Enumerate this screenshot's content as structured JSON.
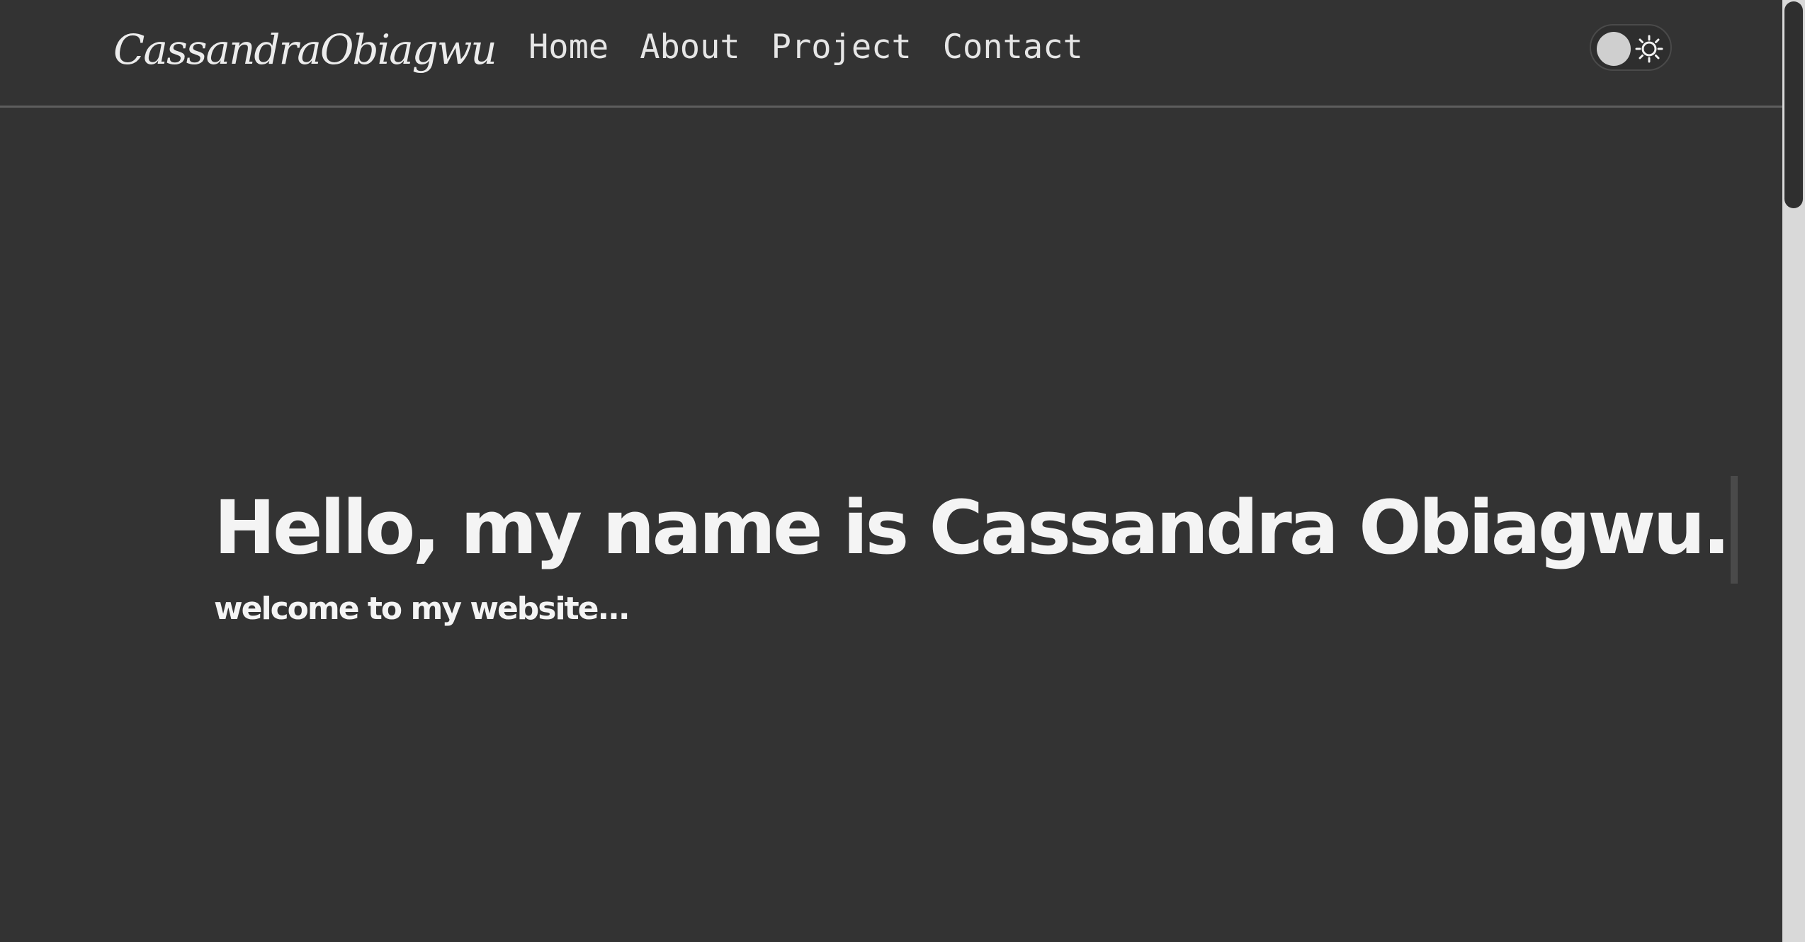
{
  "header": {
    "logo_text": "CassandraObiagwu",
    "nav": [
      {
        "label": "Home"
      },
      {
        "label": "About"
      },
      {
        "label": "Project"
      },
      {
        "label": "Contact"
      }
    ],
    "theme_toggle": {
      "icon": "sun-icon",
      "state": "dark"
    }
  },
  "hero": {
    "title": "Hello, my name is Cassandra Obiagwu.",
    "subtitle": "welcome to my website..."
  },
  "colors": {
    "background": "#333333",
    "text": "#f2f2f2",
    "divider": "#5e5e5e"
  }
}
